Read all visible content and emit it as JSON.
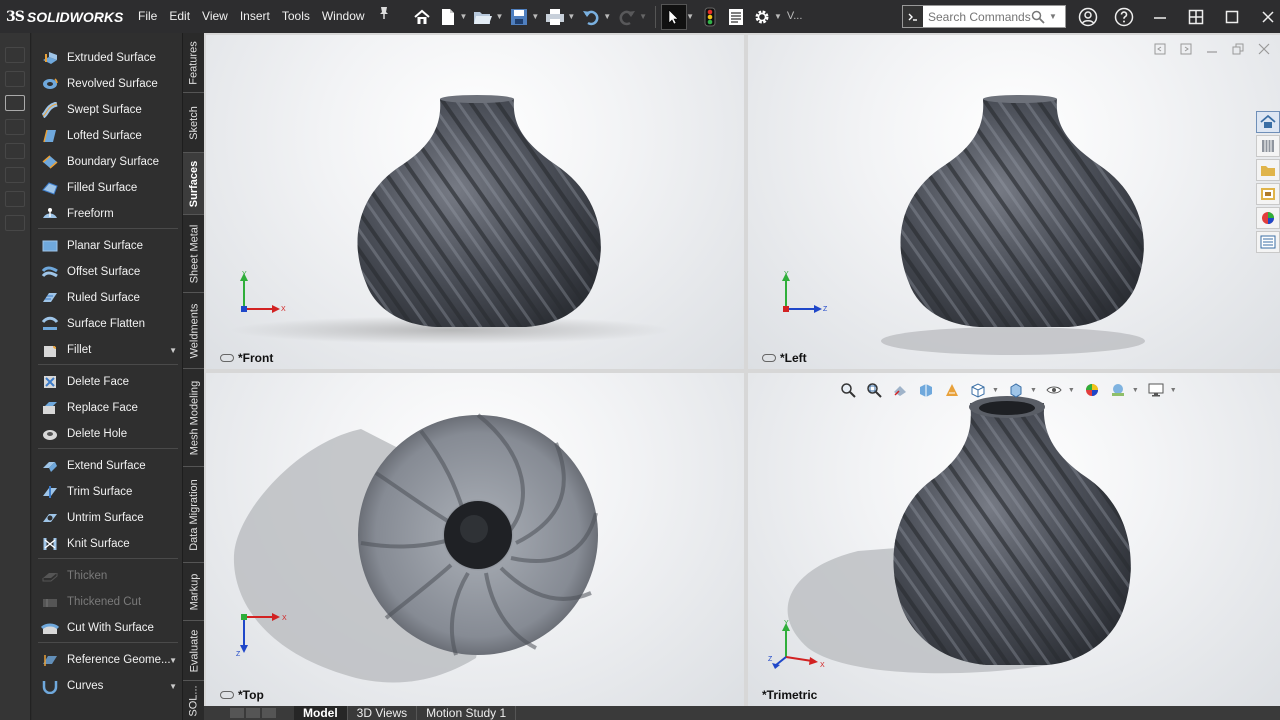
{
  "app": {
    "brand_mark": "3S",
    "brand_name": "SOLIDWORKS"
  },
  "menu": [
    "File",
    "Edit",
    "View",
    "Insert",
    "Tools",
    "Window"
  ],
  "toolbar": {
    "overflow_label": "V..."
  },
  "search": {
    "placeholder": "Search Commands"
  },
  "commands": [
    {
      "label": "Extruded Surface",
      "icon": "extruded-surface-icon"
    },
    {
      "label": "Revolved Surface",
      "icon": "revolved-surface-icon"
    },
    {
      "label": "Swept Surface",
      "icon": "swept-surface-icon"
    },
    {
      "label": "Lofted Surface",
      "icon": "lofted-surface-icon"
    },
    {
      "label": "Boundary Surface",
      "icon": "boundary-surface-icon"
    },
    {
      "label": "Filled Surface",
      "icon": "filled-surface-icon"
    },
    {
      "label": "Freeform",
      "icon": "freeform-icon"
    },
    {
      "label": "Planar Surface",
      "icon": "planar-surface-icon"
    },
    {
      "label": "Offset Surface",
      "icon": "offset-surface-icon"
    },
    {
      "label": "Ruled Surface",
      "icon": "ruled-surface-icon"
    },
    {
      "label": "Surface Flatten",
      "icon": "surface-flatten-icon"
    },
    {
      "label": "Fillet",
      "icon": "fillet-icon"
    },
    {
      "label": "Delete Face",
      "icon": "delete-face-icon"
    },
    {
      "label": "Replace Face",
      "icon": "replace-face-icon"
    },
    {
      "label": "Delete Hole",
      "icon": "delete-hole-icon"
    },
    {
      "label": "Extend Surface",
      "icon": "extend-surface-icon"
    },
    {
      "label": "Trim Surface",
      "icon": "trim-surface-icon"
    },
    {
      "label": "Untrim Surface",
      "icon": "untrim-surface-icon"
    },
    {
      "label": "Knit Surface",
      "icon": "knit-surface-icon"
    },
    {
      "label": "Thicken",
      "icon": "thicken-icon"
    },
    {
      "label": "Thickened Cut",
      "icon": "thickened-cut-icon"
    },
    {
      "label": "Cut With Surface",
      "icon": "cut-with-surface-icon"
    },
    {
      "label": "Reference Geome...",
      "icon": "reference-geometry-icon"
    },
    {
      "label": "Curves",
      "icon": "curves-icon"
    }
  ],
  "vertical_tabs": [
    "Features",
    "Sketch",
    "Surfaces",
    "Sheet Metal",
    "Weldments",
    "Mesh Modeling",
    "Data Migration",
    "Markup",
    "Evaluate",
    "SOL..."
  ],
  "viewports": {
    "front": {
      "label": "*Front",
      "axes": [
        "Y",
        "X"
      ]
    },
    "left": {
      "label": "*Left",
      "axes": [
        "Y",
        "Z"
      ]
    },
    "top": {
      "label": "*Top",
      "axes": [
        "Z",
        "X"
      ]
    },
    "trimetric": {
      "label": "*Trimetric",
      "axes": [
        "Y",
        "X",
        "Z"
      ]
    }
  },
  "bottom_tabs": [
    "Model",
    "3D Views",
    "Motion Study 1"
  ],
  "colors": {
    "accent_red": "#d9342b",
    "axis_green": "#2fae3a",
    "axis_blue": "#1f47c9",
    "axis_red": "#d22222",
    "vase": "#4a4d55"
  }
}
